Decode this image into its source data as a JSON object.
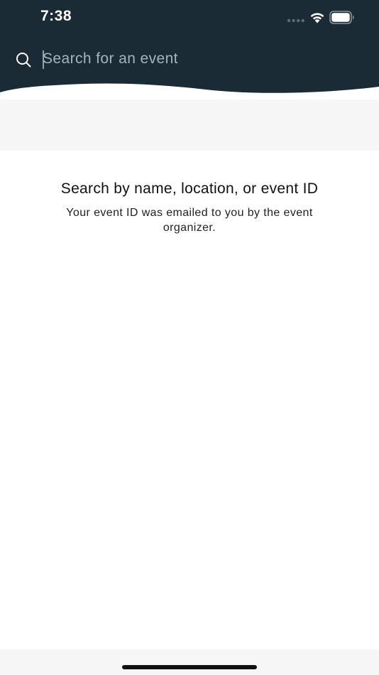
{
  "status_bar": {
    "time": "7:38"
  },
  "search": {
    "placeholder": "Search for an event",
    "value": ""
  },
  "empty_state": {
    "title": "Search by name, location, or event ID",
    "subtitle": "Your event ID was emailed to you by the event organizer."
  },
  "colors": {
    "header_background": "#1b2b35",
    "body_background": "#ffffff",
    "band_background": "#f6f6f6"
  },
  "icons": {
    "search": "search-icon",
    "wifi": "wifi-icon",
    "battery": "battery-icon",
    "signal": "cellular-signal-icon"
  }
}
